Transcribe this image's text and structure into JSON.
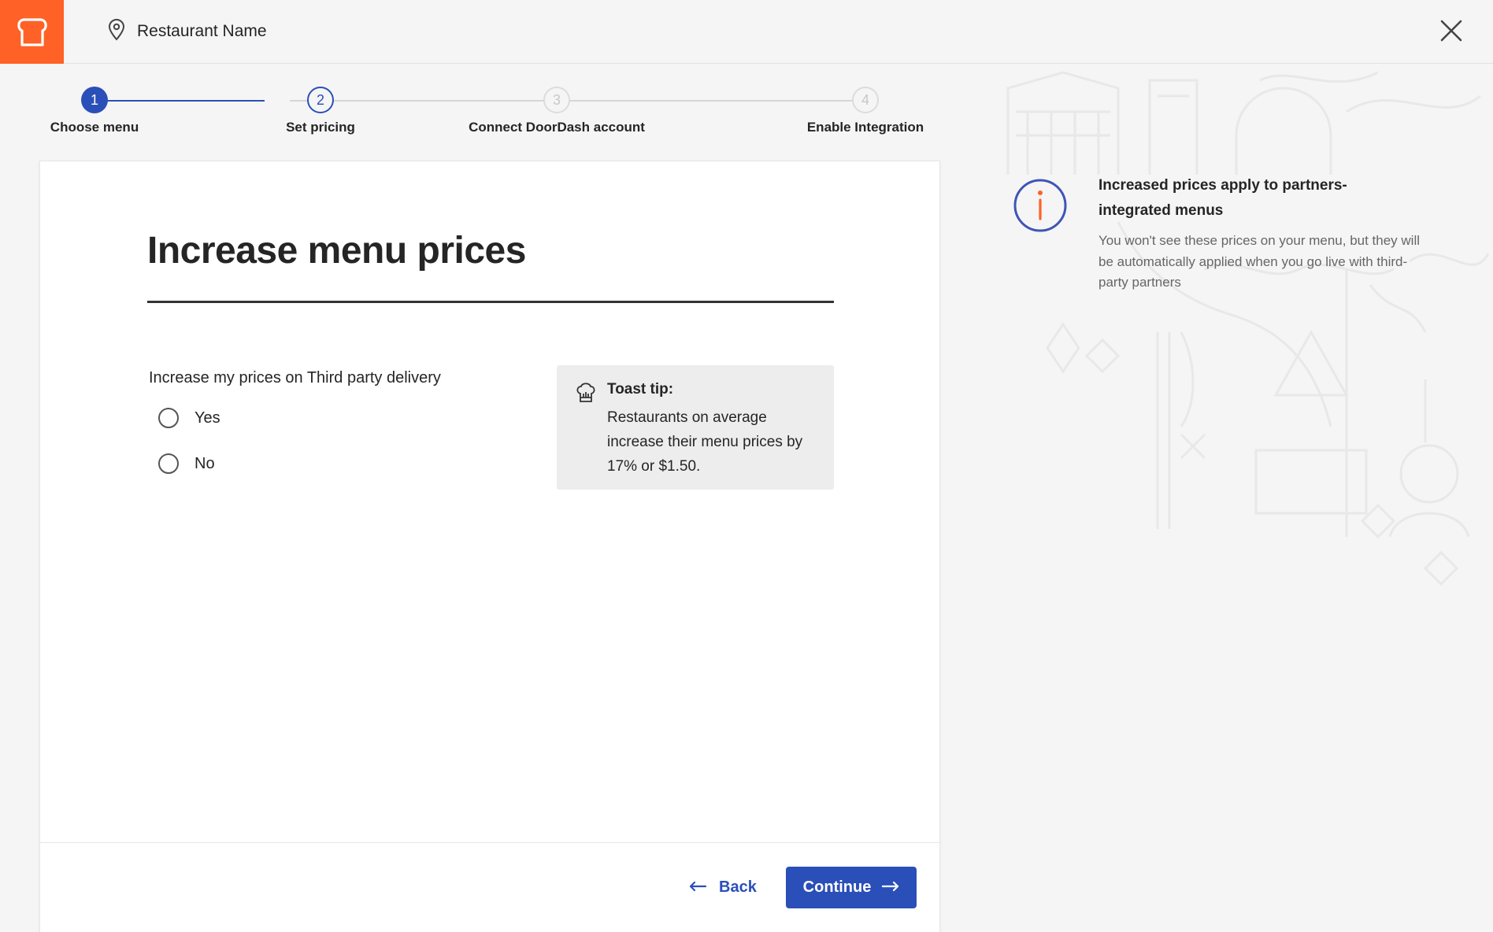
{
  "header": {
    "restaurant_name": "Restaurant Name",
    "logo_icon": "toast-logo-icon",
    "location_icon": "location-pin-icon",
    "close_icon": "close-icon"
  },
  "stepper": {
    "steps": [
      {
        "number": "1",
        "label": "Choose menu",
        "status": "done"
      },
      {
        "number": "2",
        "label": "Set pricing",
        "status": "current"
      },
      {
        "number": "3",
        "label": "Connect DoorDash account",
        "status": "todo"
      },
      {
        "number": "4",
        "label": "Enable Integration",
        "status": "todo"
      }
    ]
  },
  "main": {
    "title": "Increase menu prices",
    "question": "Increase my prices on Third party delivery",
    "options": [
      {
        "label": "Yes",
        "selected": false
      },
      {
        "label": "No",
        "selected": false
      }
    ],
    "tip": {
      "icon": "chef-hat-icon",
      "title": "Toast tip:",
      "body": "Restaurants on average increase their menu prices by 17% or $1.50."
    }
  },
  "footer": {
    "back_label": "Back",
    "continue_label": "Continue"
  },
  "side_info": {
    "icon": "info-icon",
    "title": "Increased prices apply to partners-integrated menus",
    "body": "You won't see these prices on your menu, but they will be automatically applied when you go live with third-party partners"
  },
  "colors": {
    "brand_orange": "#ff6126",
    "accent_blue": "#2b4fb9",
    "background": "#f5f5f5"
  }
}
